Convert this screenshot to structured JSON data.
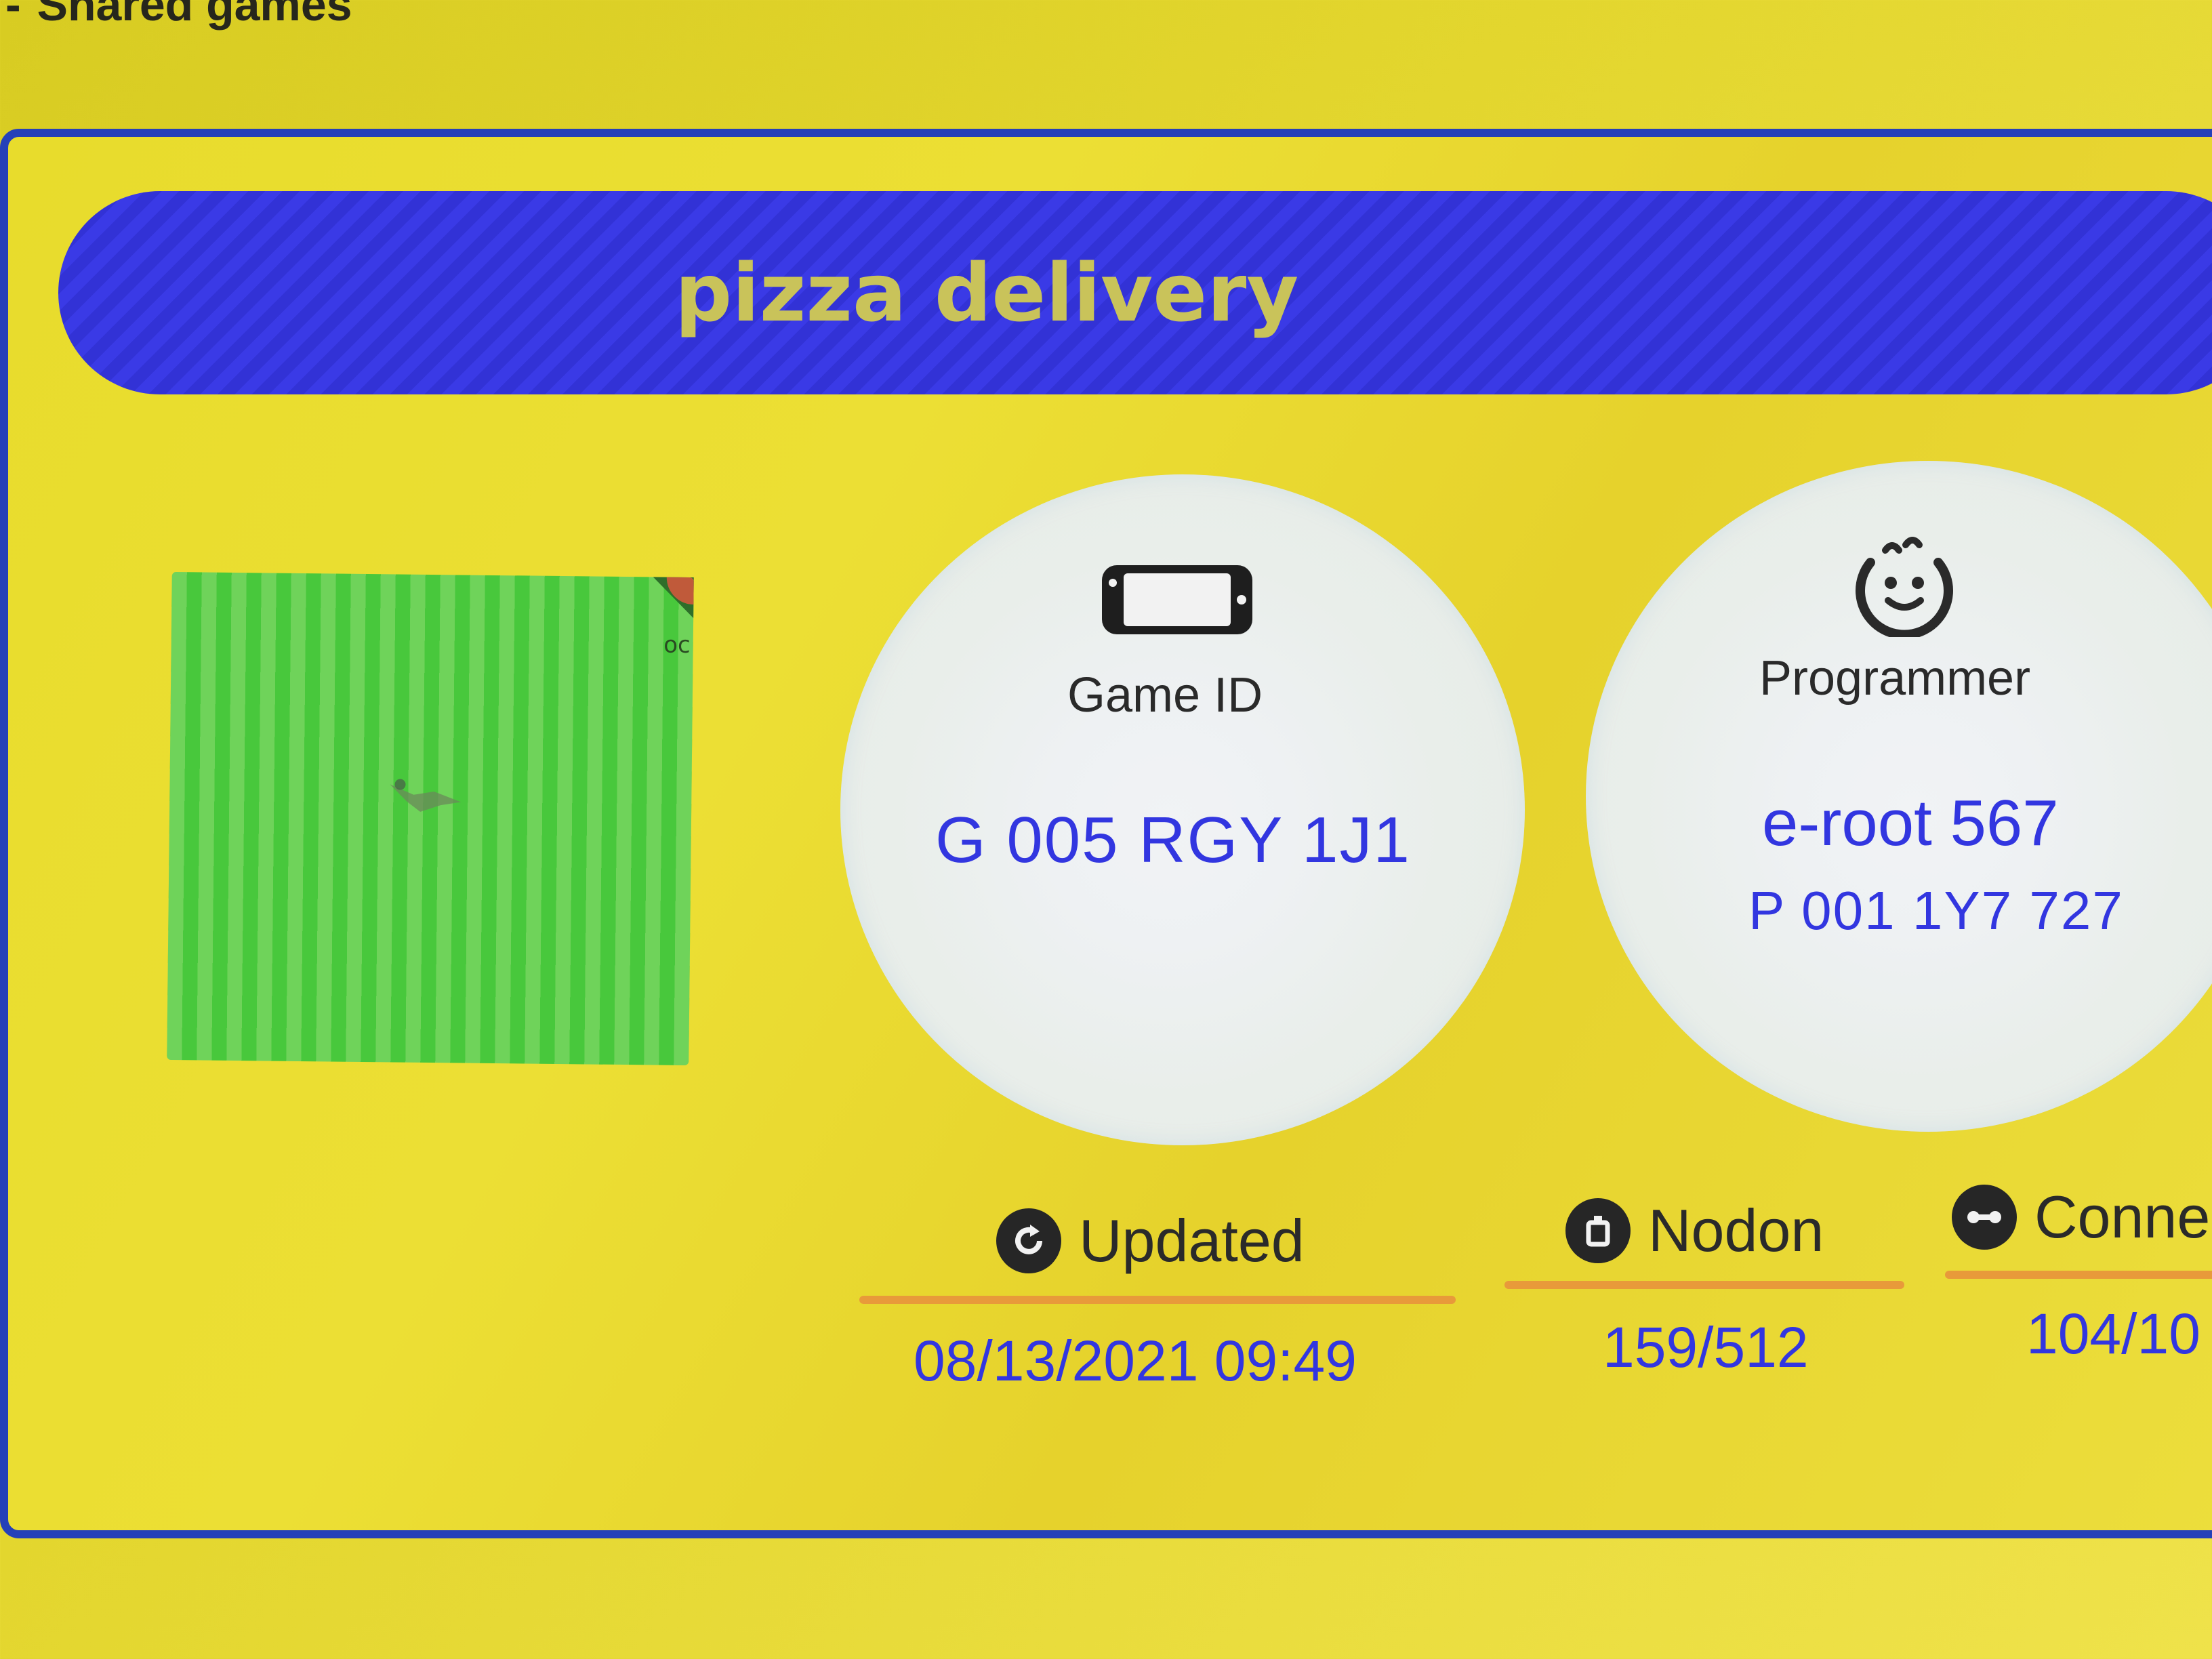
{
  "section": {
    "bullet": "-",
    "title": "Shared games"
  },
  "game": {
    "title": "pizza delivery",
    "thumbnail_mark": "oc",
    "game_id": {
      "label": "Game ID",
      "value": "G 005 RGY 1J1",
      "icon": "console-icon"
    },
    "programmer": {
      "label": "Programmer",
      "name": "e-root 567",
      "code": "P 001 1Y7 727",
      "icon": "face-icon"
    },
    "stats": {
      "updated": {
        "label": "Updated",
        "value": "08/13/2021 09:49",
        "icon": "refresh-icon"
      },
      "nodon": {
        "label": "Nodon",
        "value": "159/512",
        "icon": "nodon-icon"
      },
      "connections": {
        "label": "Connect",
        "value": "104/10",
        "icon": "connection-icon"
      }
    }
  },
  "colors": {
    "background": "#e3d62e",
    "banner": "#3a3ae6",
    "banner_text": "#c9c35a",
    "accent_blue": "#3236e0",
    "border": "#2540b8",
    "rule": "#e89a3a",
    "thumbnail_green": "#48c83c"
  }
}
